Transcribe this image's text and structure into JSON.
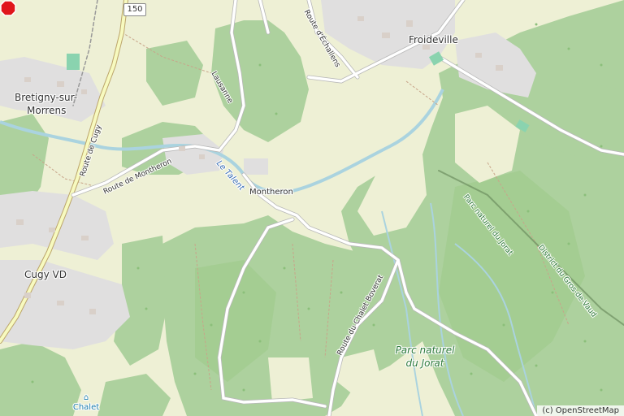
{
  "map": {
    "places": {
      "froideville": "Froideville",
      "bretigny_line1": "Bretigny-sur-",
      "bretigny_line2": "Morrens",
      "cugy": "Cugy VD",
      "montheron": "Montheron"
    },
    "roads": {
      "route_150": "150",
      "route_de_cugy": "Route de Cugy",
      "route_de_montheron": "Route de Montheron",
      "route_du_chalet_boverat": "Route du Chalet Boverat",
      "route_echallens": "Route d'Échallens",
      "lausanne": "Lausanne"
    },
    "water": {
      "le_talent": "Le Talent"
    },
    "areas": {
      "parc_line1": "Parc naturel",
      "parc_line2": "du Jorat",
      "parc_small": "Parc naturel du Jorat",
      "district": "District du Gros-de-Vaud"
    },
    "poi": {
      "chalet": "Chalet"
    },
    "attribution": "(c) OpenStreetMap",
    "colors": {
      "forest": "#add19e",
      "farmland": "#eef0d5",
      "residential": "#e0dfdf",
      "water": "#aad3df",
      "marker": "#e0161b"
    }
  }
}
